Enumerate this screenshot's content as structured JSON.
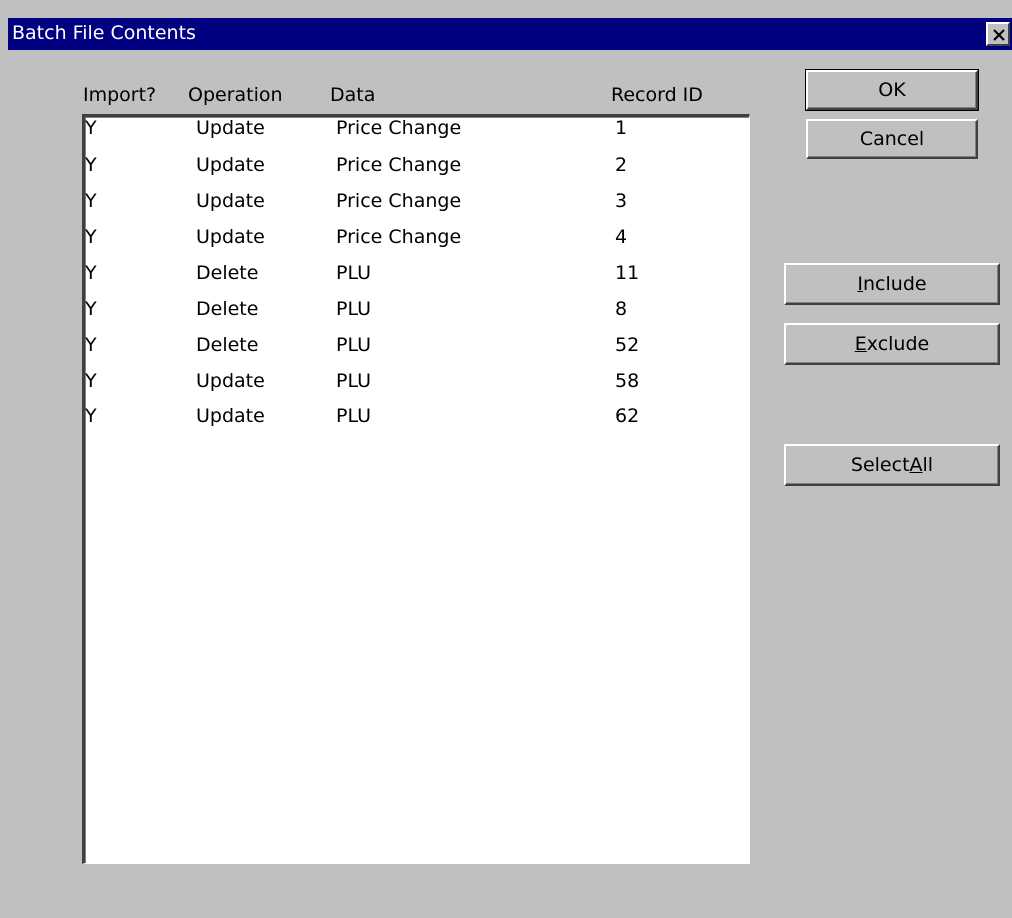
{
  "window": {
    "title": "Batch File Contents"
  },
  "columns": {
    "import": "Import?",
    "operation": "Operation",
    "data": "Data",
    "record_id": "Record ID"
  },
  "rows": [
    {
      "import": "Y",
      "operation": "Update",
      "data": "Price Change",
      "record_id": "1"
    },
    {
      "import": "Y",
      "operation": "Update",
      "data": "Price Change",
      "record_id": "2"
    },
    {
      "import": "Y",
      "operation": "Update",
      "data": "Price Change",
      "record_id": "3"
    },
    {
      "import": "Y",
      "operation": "Update",
      "data": "Price Change",
      "record_id": "4"
    },
    {
      "import": "Y",
      "operation": "Delete",
      "data": "PLU",
      "record_id": "11"
    },
    {
      "import": "Y",
      "operation": "Delete",
      "data": "PLU",
      "record_id": "8"
    },
    {
      "import": "Y",
      "operation": "Delete",
      "data": "PLU",
      "record_id": "52"
    },
    {
      "import": "Y",
      "operation": "Update",
      "data": "PLU",
      "record_id": "58"
    },
    {
      "import": "Y",
      "operation": "Update",
      "data": "PLU",
      "record_id": "62"
    }
  ],
  "buttons": {
    "ok": "OK",
    "cancel": "Cancel",
    "include": {
      "mnemonic": "I",
      "rest": "nclude"
    },
    "exclude": {
      "mnemonic": "E",
      "rest": "xclude"
    },
    "select_all": {
      "prefix": "Select ",
      "mnemonic": "A",
      "rest": "ll"
    }
  },
  "colors": {
    "titlebar": "#000080",
    "face": "#c0c0c0"
  },
  "icons": {
    "close": "close-icon"
  }
}
